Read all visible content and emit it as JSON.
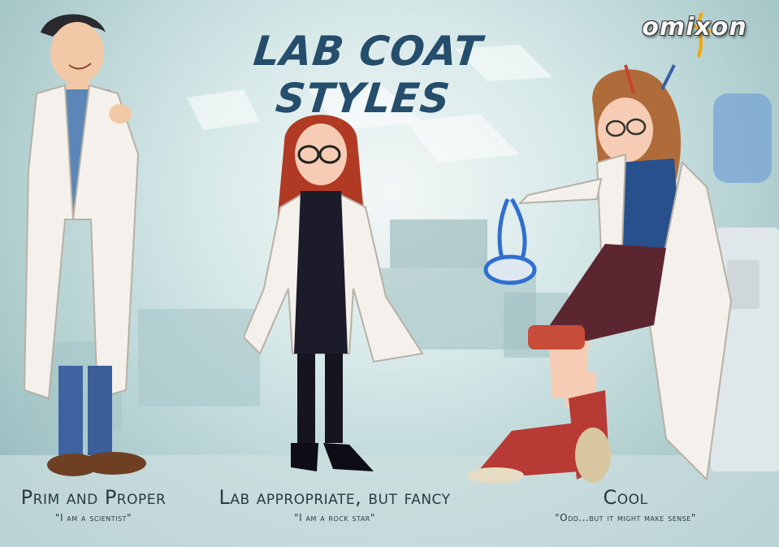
{
  "title": "LAB COAT STYLES",
  "logo": {
    "text": "omixon",
    "accent_color": "#f5a800"
  },
  "styles": [
    {
      "name": "Prim and Proper",
      "quote": "\"I am a scientist\""
    },
    {
      "name": "Lab appropriate, but fancy",
      "quote": "\"I am a rock star\""
    },
    {
      "name": "Cool",
      "quote": "\"Odd...but it might make sense\""
    }
  ],
  "colors": {
    "title": "#254d6c",
    "background_light": "#f3f8f7",
    "background_dark": "#8db5b8",
    "lab_coat": "#f4f1ec",
    "goggles": "#2f6fd0"
  }
}
